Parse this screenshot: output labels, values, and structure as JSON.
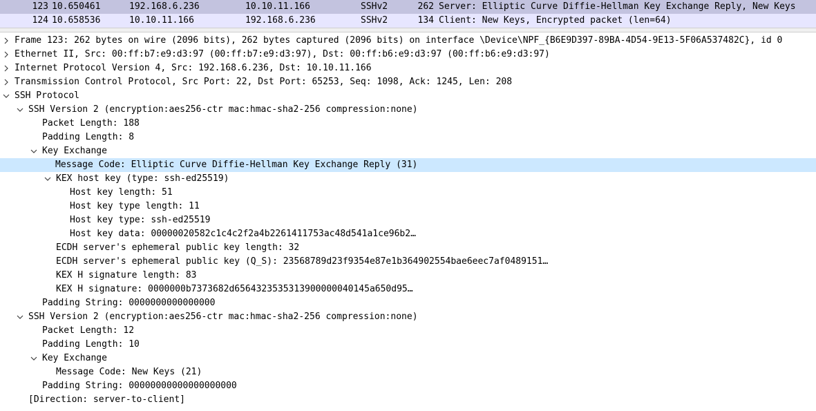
{
  "packet_list": {
    "rows": [
      {
        "no": "123",
        "time": "10.650461",
        "src": "192.168.6.236",
        "dst": "10.10.11.166",
        "proto": "SSHv2",
        "len": "262",
        "info": "Server: Elliptic Curve Diffie-Hellman Key Exchange Reply, New Keys"
      },
      {
        "no": "124",
        "time": "10.658536",
        "src": "10.10.11.166",
        "dst": "192.168.6.236",
        "proto": "SSHv2",
        "len": "134",
        "info": "Client: New Keys, Encrypted packet (len=64)"
      }
    ]
  },
  "details": {
    "frame": "Frame 123: 262 bytes on wire (2096 bits), 262 bytes captured (2096 bits) on interface \\Device\\NPF_{B6E9D397-89BA-4D54-9E13-5F06A537482C}, id 0",
    "ethernet": "Ethernet II, Src: 00:ff:b7:e9:d3:97 (00:ff:b7:e9:d3:97), Dst: 00:ff:b6:e9:d3:97 (00:ff:b6:e9:d3:97)",
    "ip": "Internet Protocol Version 4, Src: 192.168.6.236, Dst: 10.10.11.166",
    "tcp": "Transmission Control Protocol, Src Port: 22, Dst Port: 65253, Seq: 1098, Ack: 1245, Len: 208",
    "ssh": "SSH Protocol",
    "ssh_v1": "SSH Version 2 (encryption:aes256-ctr mac:hmac-sha2-256 compression:none)",
    "v1_packet_length": "Packet Length: 188",
    "v1_padding_length": "Padding Length: 8",
    "v1_key_exchange": "Key Exchange",
    "v1_msg_code": "Message Code: Elliptic Curve Diffie-Hellman Key Exchange Reply (31)",
    "kex_host_key": "KEX host key (type: ssh-ed25519)",
    "host_key_length": "Host key length: 51",
    "host_key_type_length": "Host key type length: 11",
    "host_key_type": "Host key type: ssh-ed25519",
    "host_key_data": "Host key data: 00000020582c1c4c2f2a4b2261411753ac48d541a1ce96b2…",
    "ecdh_pubkey_length": "ECDH server's ephemeral public key length: 32",
    "ecdh_pubkey": "ECDH server's ephemeral public key (Q_S): 23568789d23f9354e87e1b364902554bae6eec7af0489151…",
    "kex_h_sig_length": "KEX H signature length: 83",
    "kex_h_sig": "KEX H signature: 0000000b7373682d6564323535313900000040145a650d95…",
    "v1_padding_string": "Padding String: 0000000000000000",
    "ssh_v2": "SSH Version 2 (encryption:aes256-ctr mac:hmac-sha2-256 compression:none)",
    "v2_packet_length": "Packet Length: 12",
    "v2_padding_length": "Padding Length: 10",
    "v2_key_exchange": "Key Exchange",
    "v2_msg_code": "Message Code: New Keys (21)",
    "v2_padding_string": "Padding String: 00000000000000000000",
    "direction": "[Direction: server-to-client]"
  },
  "colors": {
    "selected_packet_bg": "#c3c3df",
    "other_packet_bg": "#e7e6ff",
    "selected_detail_bg": "#cce8ff",
    "expander_color": "#404040"
  }
}
